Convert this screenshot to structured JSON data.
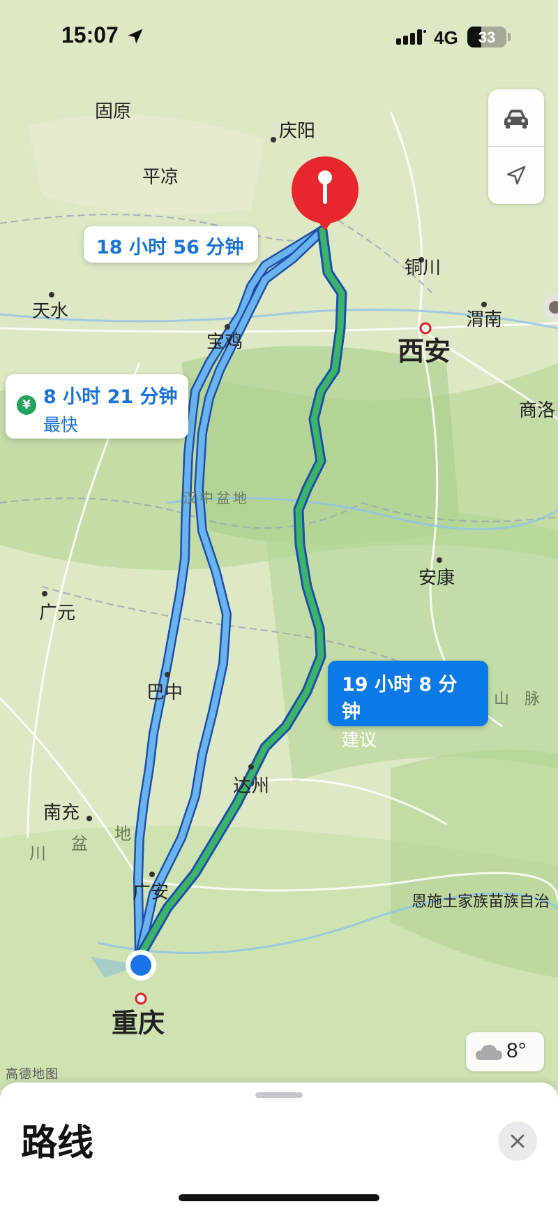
{
  "status_bar": {
    "time": "15:07",
    "network": "4G",
    "battery": "33"
  },
  "map": {
    "attribution": "高德地图",
    "cities": [
      {
        "name": "固原"
      },
      {
        "name": "平凉"
      },
      {
        "name": "庆阳"
      },
      {
        "name": "铜川"
      },
      {
        "name": "渭南"
      },
      {
        "name": "西安"
      },
      {
        "name": "天水"
      },
      {
        "name": "宝鸡"
      },
      {
        "name": "商洛"
      },
      {
        "name": "安康"
      },
      {
        "name": "广元"
      },
      {
        "name": "巴中"
      },
      {
        "name": "达州"
      },
      {
        "name": "南充"
      },
      {
        "name": "广安"
      },
      {
        "name": "重庆"
      },
      {
        "name": "恩施土家族苗族自治"
      }
    ],
    "regions": {
      "hanzhong_basin": "汉中盆地",
      "sichuan_basin": [
        "川",
        "盆",
        "地"
      ],
      "mountains": [
        "山",
        "脉"
      ]
    }
  },
  "routes": {
    "route_a": {
      "duration": "18 小时 56 分钟"
    },
    "route_b": {
      "duration": "8 小时 21 分钟",
      "tag": "最快",
      "toll_icon": "¥"
    },
    "route_c": {
      "duration": "19 小时 8 分钟",
      "tag": "建议"
    }
  },
  "weather": {
    "temperature": "8°",
    "icon": "cloud-icon"
  },
  "sheet": {
    "title": "路线"
  },
  "colors": {
    "route_alt": "#5aa9ea",
    "route_selected": "#3db36a",
    "route_outline": "#1d4fa8",
    "pin": "#e8262d",
    "accent": "#0b7ae6"
  }
}
